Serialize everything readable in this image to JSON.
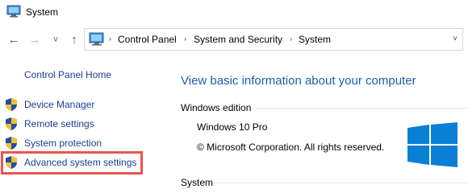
{
  "window": {
    "title": "System",
    "icon": "monitor-icon"
  },
  "navigation": {
    "back": "←",
    "forward": "→",
    "recent": "˅",
    "up": "↑",
    "breadcrumbs": [
      "Control Panel",
      "System and Security",
      "System"
    ],
    "separator": "›",
    "dropdown": "˅"
  },
  "sidebar": {
    "home_link": "Control Panel Home",
    "items": [
      {
        "label": "Device Manager",
        "icon": "shield-icon"
      },
      {
        "label": "Remote settings",
        "icon": "shield-icon"
      },
      {
        "label": "System protection",
        "icon": "shield-icon"
      },
      {
        "label": "Advanced system settings",
        "icon": "shield-icon",
        "highlighted": true
      }
    ]
  },
  "main": {
    "heading": "View basic information about your computer",
    "edition_section": {
      "label": "Windows edition",
      "product": "Windows 10 Pro",
      "copyright": "© Microsoft Corporation. All rights reserved."
    },
    "system_section": {
      "label": "System"
    }
  },
  "colors": {
    "link": "#1a3f8f",
    "heading": "#1e5ea8",
    "highlight": "#e8564d",
    "windows_logo": "#0a7fd6"
  }
}
